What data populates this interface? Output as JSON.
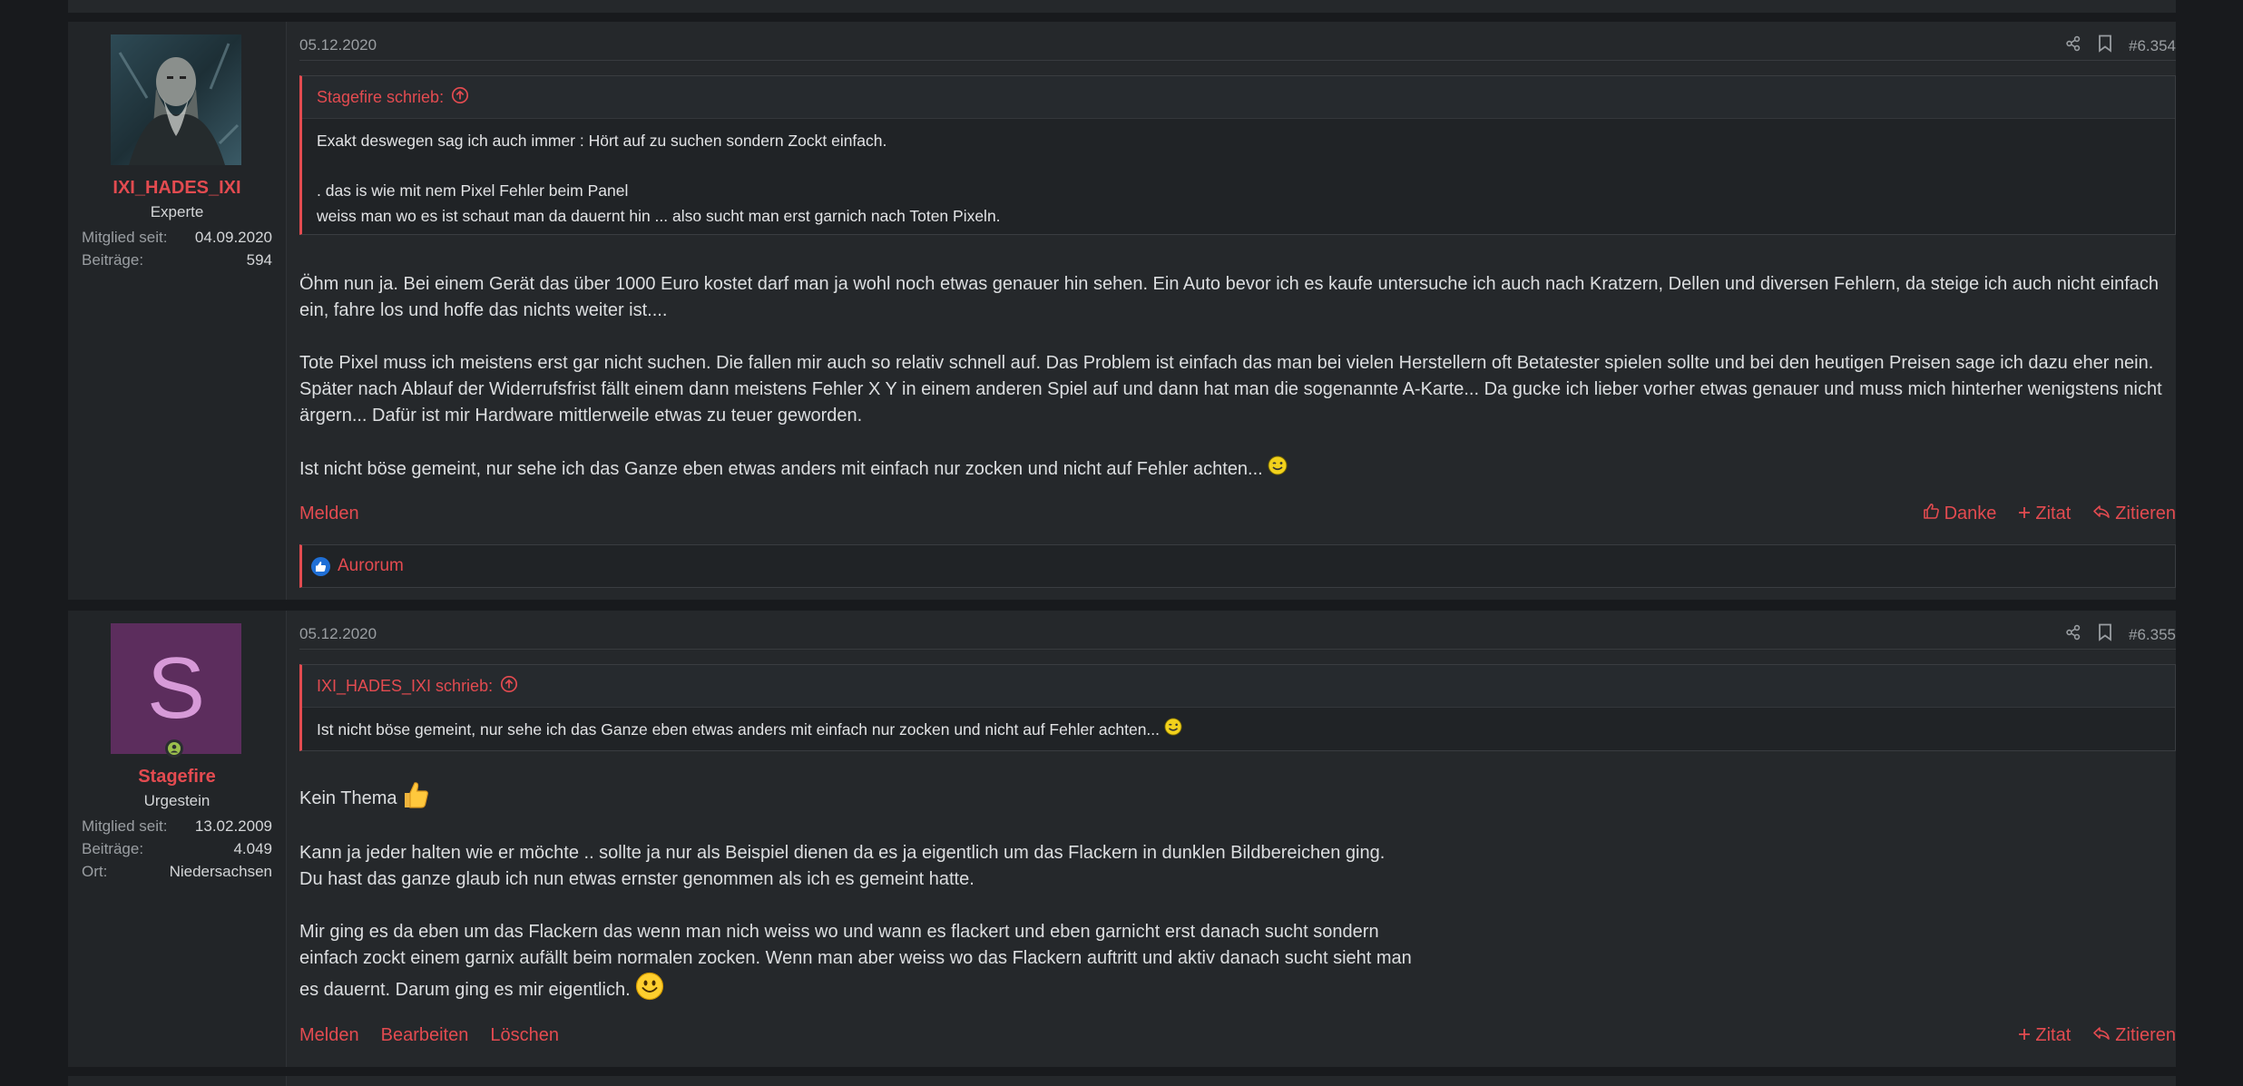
{
  "posts": [
    {
      "date": "05.12.2020",
      "number": "#6.354",
      "author": {
        "name": "IXI_HADES_IXI",
        "title": "Experte",
        "stats": [
          {
            "label": "Mitglied seit:",
            "value": "04.09.2020"
          },
          {
            "label": "Beiträge:",
            "value": "594"
          }
        ]
      },
      "quote": {
        "header": "Stagefire schrieb:",
        "lines": [
          "Exakt deswegen sag ich auch immer : Hört auf zu suchen sondern Zockt einfach.",
          "",
          ". das is wie mit nem Pixel Fehler beim Panel",
          "weiss man wo es ist schaut man da dauernt hin ... also sucht man erst garnich nach Toten Pixeln."
        ]
      },
      "paragraphs": [
        "Öhm nun ja. Bei einem Gerät das über 1000 Euro kostet darf man ja wohl noch etwas genauer hin sehen. Ein Auto bevor ich es kaufe untersuche ich auch nach Kratzern, Dellen und diversen Fehlern, da steige ich auch nicht einfach ein, fahre los und hoffe das nichts weiter ist....",
        "Tote Pixel muss ich meistens erst gar nicht suchen. Die fallen mir auch so relativ schnell auf. Das Problem ist einfach das man bei vielen Herstellern oft Betatester spielen sollte und bei den heutigen Preisen sage ich dazu eher nein. Später nach Ablauf der Widerrufsfrist fällt einem dann meistens Fehler X Y in einem anderen Spiel auf und dann hat man die sogenannte A-Karte... Da gucke ich lieber vorher etwas genauer und muss mich hinterher wenigstens nicht ärgern... Dafür ist mir Hardware mittlerweile etwas zu teuer geworden.",
        "Ist nicht böse gemeint, nur sehe ich das Ganze eben etwas anders mit einfach nur zocken und nicht auf Fehler achten..."
      ],
      "actions_left": [
        "Melden"
      ],
      "actions_right": [
        "Danke",
        "Zitat",
        "Zitieren"
      ],
      "reaction_user": "Aurorum"
    },
    {
      "date": "05.12.2020",
      "number": "#6.355",
      "author": {
        "avatar_letter": "S",
        "name": "Stagefire",
        "title": "Urgestein",
        "stats": [
          {
            "label": "Mitglied seit:",
            "value": "13.02.2009"
          },
          {
            "label": "Beiträge:",
            "value": "4.049"
          },
          {
            "label": "Ort:",
            "value": "Niedersachsen"
          }
        ]
      },
      "quote": {
        "header": "IXI_HADES_IXI schrieb:",
        "lines": [
          "Ist nicht böse gemeint, nur sehe ich das Ganze eben etwas anders mit einfach nur zocken und nicht auf Fehler achten..."
        ]
      },
      "paragraphs": [
        "Kein Thema",
        "Kann ja jeder halten wie er möchte .. sollte ja nur als Beispiel dienen da es ja eigentlich um das Flackern in dunklen Bildbereichen ging.",
        "Du hast das ganze glaub ich nun etwas ernster genommen als ich es gemeint hatte.",
        "Mir ging es da eben um das Flackern das wenn man nich weiss wo und wann es flackert und eben garnicht erst danach sucht sondern",
        "einfach zockt einem garnix aufällt beim normalen zocken. Wenn man aber weiss wo das Flackern auftritt und aktiv danach sucht sieht man",
        "es dauernt. Darum ging es mir eigentlich."
      ],
      "actions_left": [
        "Melden",
        "Bearbeiten",
        "Löschen"
      ],
      "actions_right": [
        "Zitat",
        "Zitieren"
      ]
    }
  ],
  "colors": {
    "accent": "#e34b50",
    "background": "#181a1d",
    "post_bg": "#25282b",
    "avatar_purple": "#5c2d5d",
    "online": "#9bc04c"
  },
  "icons": [
    "share-icon",
    "bookmark-icon",
    "arrow-up-circle-icon",
    "thumbs-up-icon",
    "plus-icon",
    "reply-icon",
    "wink-smiley-icon",
    "thumbs-up-emoji-icon",
    "smile-emoji-icon"
  ]
}
